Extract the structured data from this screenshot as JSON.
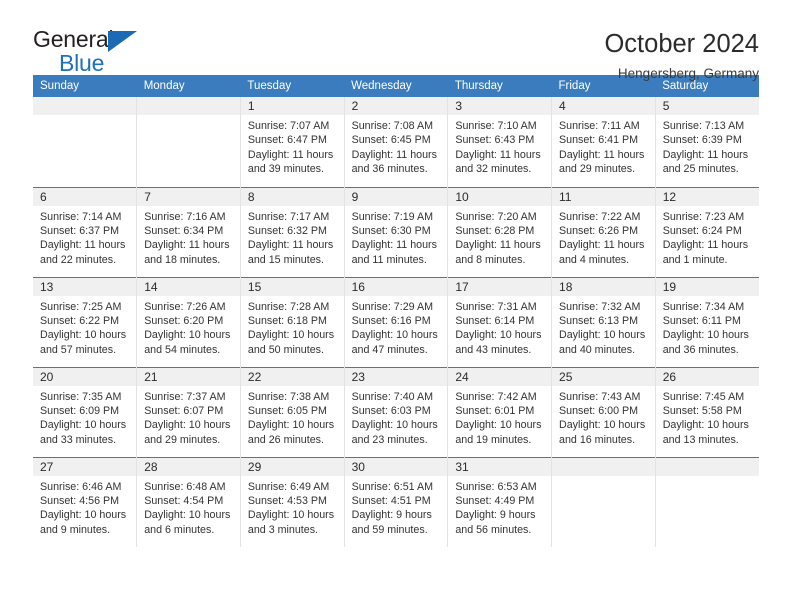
{
  "brand": {
    "name_part1": "General",
    "name_part2": "Blue",
    "triangle_color": "#1a6ab5",
    "blue_color": "#1f6fbf"
  },
  "header": {
    "title": "October 2024",
    "subtitle": "Hengersberg, Germany"
  },
  "theme": {
    "header_blue": "#3b7cbf",
    "daynum_bg": "#f0f0f0",
    "cell_border": "#e3e3e3"
  },
  "weekday_headers": [
    "Sunday",
    "Monday",
    "Tuesday",
    "Wednesday",
    "Thursday",
    "Friday",
    "Saturday"
  ],
  "labels": {
    "sunrise_prefix": "Sunrise: ",
    "sunset_prefix": "Sunset: ",
    "daylight_prefix": "Daylight: "
  },
  "weeks": [
    [
      {
        "day": "",
        "sunrise": "",
        "sunset": "",
        "daylight": ""
      },
      {
        "day": "",
        "sunrise": "",
        "sunset": "",
        "daylight": ""
      },
      {
        "day": "1",
        "sunrise": "Sunrise: 7:07 AM",
        "sunset": "Sunset: 6:47 PM",
        "daylight": "Daylight: 11 hours and 39 minutes."
      },
      {
        "day": "2",
        "sunrise": "Sunrise: 7:08 AM",
        "sunset": "Sunset: 6:45 PM",
        "daylight": "Daylight: 11 hours and 36 minutes."
      },
      {
        "day": "3",
        "sunrise": "Sunrise: 7:10 AM",
        "sunset": "Sunset: 6:43 PM",
        "daylight": "Daylight: 11 hours and 32 minutes."
      },
      {
        "day": "4",
        "sunrise": "Sunrise: 7:11 AM",
        "sunset": "Sunset: 6:41 PM",
        "daylight": "Daylight: 11 hours and 29 minutes."
      },
      {
        "day": "5",
        "sunrise": "Sunrise: 7:13 AM",
        "sunset": "Sunset: 6:39 PM",
        "daylight": "Daylight: 11 hours and 25 minutes."
      }
    ],
    [
      {
        "day": "6",
        "sunrise": "Sunrise: 7:14 AM",
        "sunset": "Sunset: 6:37 PM",
        "daylight": "Daylight: 11 hours and 22 minutes."
      },
      {
        "day": "7",
        "sunrise": "Sunrise: 7:16 AM",
        "sunset": "Sunset: 6:34 PM",
        "daylight": "Daylight: 11 hours and 18 minutes."
      },
      {
        "day": "8",
        "sunrise": "Sunrise: 7:17 AM",
        "sunset": "Sunset: 6:32 PM",
        "daylight": "Daylight: 11 hours and 15 minutes."
      },
      {
        "day": "9",
        "sunrise": "Sunrise: 7:19 AM",
        "sunset": "Sunset: 6:30 PM",
        "daylight": "Daylight: 11 hours and 11 minutes."
      },
      {
        "day": "10",
        "sunrise": "Sunrise: 7:20 AM",
        "sunset": "Sunset: 6:28 PM",
        "daylight": "Daylight: 11 hours and 8 minutes."
      },
      {
        "day": "11",
        "sunrise": "Sunrise: 7:22 AM",
        "sunset": "Sunset: 6:26 PM",
        "daylight": "Daylight: 11 hours and 4 minutes."
      },
      {
        "day": "12",
        "sunrise": "Sunrise: 7:23 AM",
        "sunset": "Sunset: 6:24 PM",
        "daylight": "Daylight: 11 hours and 1 minute."
      }
    ],
    [
      {
        "day": "13",
        "sunrise": "Sunrise: 7:25 AM",
        "sunset": "Sunset: 6:22 PM",
        "daylight": "Daylight: 10 hours and 57 minutes."
      },
      {
        "day": "14",
        "sunrise": "Sunrise: 7:26 AM",
        "sunset": "Sunset: 6:20 PM",
        "daylight": "Daylight: 10 hours and 54 minutes."
      },
      {
        "day": "15",
        "sunrise": "Sunrise: 7:28 AM",
        "sunset": "Sunset: 6:18 PM",
        "daylight": "Daylight: 10 hours and 50 minutes."
      },
      {
        "day": "16",
        "sunrise": "Sunrise: 7:29 AM",
        "sunset": "Sunset: 6:16 PM",
        "daylight": "Daylight: 10 hours and 47 minutes."
      },
      {
        "day": "17",
        "sunrise": "Sunrise: 7:31 AM",
        "sunset": "Sunset: 6:14 PM",
        "daylight": "Daylight: 10 hours and 43 minutes."
      },
      {
        "day": "18",
        "sunrise": "Sunrise: 7:32 AM",
        "sunset": "Sunset: 6:13 PM",
        "daylight": "Daylight: 10 hours and 40 minutes."
      },
      {
        "day": "19",
        "sunrise": "Sunrise: 7:34 AM",
        "sunset": "Sunset: 6:11 PM",
        "daylight": "Daylight: 10 hours and 36 minutes."
      }
    ],
    [
      {
        "day": "20",
        "sunrise": "Sunrise: 7:35 AM",
        "sunset": "Sunset: 6:09 PM",
        "daylight": "Daylight: 10 hours and 33 minutes."
      },
      {
        "day": "21",
        "sunrise": "Sunrise: 7:37 AM",
        "sunset": "Sunset: 6:07 PM",
        "daylight": "Daylight: 10 hours and 29 minutes."
      },
      {
        "day": "22",
        "sunrise": "Sunrise: 7:38 AM",
        "sunset": "Sunset: 6:05 PM",
        "daylight": "Daylight: 10 hours and 26 minutes."
      },
      {
        "day": "23",
        "sunrise": "Sunrise: 7:40 AM",
        "sunset": "Sunset: 6:03 PM",
        "daylight": "Daylight: 10 hours and 23 minutes."
      },
      {
        "day": "24",
        "sunrise": "Sunrise: 7:42 AM",
        "sunset": "Sunset: 6:01 PM",
        "daylight": "Daylight: 10 hours and 19 minutes."
      },
      {
        "day": "25",
        "sunrise": "Sunrise: 7:43 AM",
        "sunset": "Sunset: 6:00 PM",
        "daylight": "Daylight: 10 hours and 16 minutes."
      },
      {
        "day": "26",
        "sunrise": "Sunrise: 7:45 AM",
        "sunset": "Sunset: 5:58 PM",
        "daylight": "Daylight: 10 hours and 13 minutes."
      }
    ],
    [
      {
        "day": "27",
        "sunrise": "Sunrise: 6:46 AM",
        "sunset": "Sunset: 4:56 PM",
        "daylight": "Daylight: 10 hours and 9 minutes."
      },
      {
        "day": "28",
        "sunrise": "Sunrise: 6:48 AM",
        "sunset": "Sunset: 4:54 PM",
        "daylight": "Daylight: 10 hours and 6 minutes."
      },
      {
        "day": "29",
        "sunrise": "Sunrise: 6:49 AM",
        "sunset": "Sunset: 4:53 PM",
        "daylight": "Daylight: 10 hours and 3 minutes."
      },
      {
        "day": "30",
        "sunrise": "Sunrise: 6:51 AM",
        "sunset": "Sunset: 4:51 PM",
        "daylight": "Daylight: 9 hours and 59 minutes."
      },
      {
        "day": "31",
        "sunrise": "Sunrise: 6:53 AM",
        "sunset": "Sunset: 4:49 PM",
        "daylight": "Daylight: 9 hours and 56 minutes."
      },
      {
        "day": "",
        "sunrise": "",
        "sunset": "",
        "daylight": ""
      },
      {
        "day": "",
        "sunrise": "",
        "sunset": "",
        "daylight": ""
      }
    ]
  ]
}
